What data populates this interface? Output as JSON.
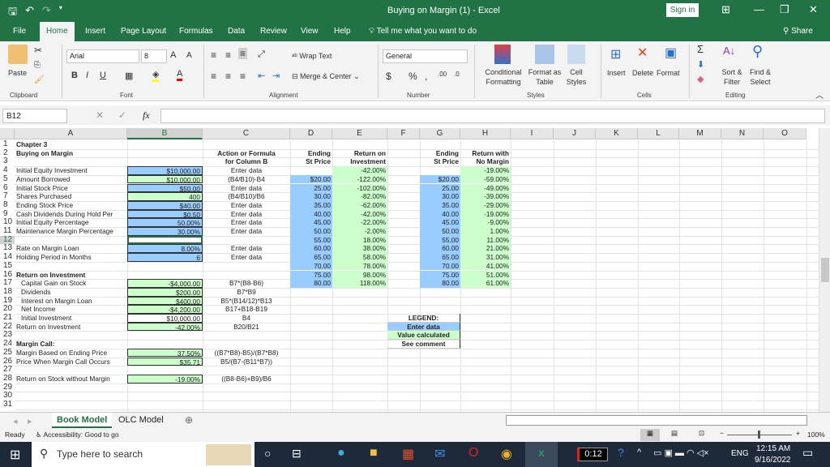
{
  "app": {
    "title": "Buying on Margin (1)  -  Excel",
    "sign_in": "Sign in"
  },
  "tabs": [
    "File",
    "Home",
    "Insert",
    "Page Layout",
    "Formulas",
    "Data",
    "Review",
    "View",
    "Help"
  ],
  "tell_me": "Tell me what you want to do",
  "share": "Share",
  "ribbon": {
    "clipboard": {
      "paste": "Paste",
      "label": "Clipboard"
    },
    "font": {
      "name": "Arial",
      "size": "8",
      "label": "Font"
    },
    "alignment": {
      "wrap_text": "Wrap Text",
      "merge_center": "Merge & Center",
      "label": "Alignment"
    },
    "number": {
      "format": "General",
      "label": "Number"
    },
    "styles": {
      "conditional": "Conditional Formatting",
      "format_table": "Format as Table",
      "cell_styles": "Cell Styles",
      "label": "Styles"
    },
    "cells": {
      "insert": "Insert",
      "delete": "Delete",
      "format": "Format",
      "label": "Cells"
    },
    "editing": {
      "sort": "Sort & Filter",
      "find": "Find & Select",
      "label": "Editing"
    }
  },
  "formula_bar": {
    "name_box": "B12",
    "fx": "fx",
    "value": ""
  },
  "columns": [
    "A",
    "B",
    "C",
    "D",
    "E",
    "F",
    "G",
    "H",
    "I",
    "J",
    "K",
    "L",
    "M",
    "N",
    "O"
  ],
  "sheet": {
    "A1": "Chapter 3",
    "A2": "Buying on Margin",
    "C2": "Action or Formula",
    "C3": "for Column B",
    "D2": "Ending",
    "D3": "St Price",
    "E2": "Return on",
    "E3": "Investment",
    "G2": "Ending",
    "G3": "St Price",
    "H2": "Return with",
    "H3": "No Margin",
    "rows_a": [
      [
        "Initial Equity Investment",
        "$10,000.00",
        "Enter data"
      ],
      [
        "Amount Borrowed",
        "$10,000.00",
        "(B4/B10)-B4"
      ],
      [
        "Initial Stock Price",
        "$50.00",
        "Enter data"
      ],
      [
        "Shares Purchased",
        "400",
        "(B4/B10)/B6"
      ],
      [
        "Ending Stock Price",
        "$40.00",
        "Enter data"
      ],
      [
        "Cash Dividends During Hold Per",
        "$0.50",
        "Enter data"
      ],
      [
        "Initial Equity Percentage",
        "50.00%",
        "Enter data"
      ],
      [
        "Maintenance Margin Percentage",
        "30.00%",
        "Enter data"
      ]
    ],
    "rows_b": [
      [
        "Rate on Margin Loan",
        "8.00%",
        "Enter data"
      ],
      [
        "Holding Period in Months",
        "6",
        "Enter data"
      ]
    ],
    "A16": "Return on Investment",
    "rows_c": [
      [
        "Capital Gain on Stock",
        "-$4,000.00",
        "B7*(B8-B6)"
      ],
      [
        "Dividends",
        "$200.00",
        "B7*B9"
      ],
      [
        "Interest on Margin Loan",
        "$400.00",
        "B5*(B14/12)*B13"
      ],
      [
        "Net Income",
        "-$4,200.00",
        "B17+B18-B19"
      ],
      [
        "Initial Investment",
        "$10,000.00",
        "B4"
      ],
      [
        "Return on Investment",
        "-42.00%",
        "B20/B21"
      ]
    ],
    "A24": "Margin Call:",
    "rows_d": [
      [
        "Margin Based on Ending Price",
        "37.50%",
        "((B7*B8)-B5)/(B7*B8)"
      ],
      [
        "Price When Margin Call Occurs",
        "$35.71",
        "B5/(B7-(B11*B7))"
      ]
    ],
    "row28": [
      "Return on Stock without Margin",
      "-19.00%",
      "((B8-B6)+B9)/B6"
    ],
    "E4": "-42.00%",
    "H4": "-19.00%",
    "price_table": [
      [
        "$20.00",
        "-122.00%",
        "$20.00",
        "-59.00%"
      ],
      [
        "25.00",
        "-102.00%",
        "25.00",
        "-49.00%"
      ],
      [
        "30.00",
        "-82.00%",
        "30.00",
        "-39.00%"
      ],
      [
        "35.00",
        "-62.00%",
        "35.00",
        "-29.00%"
      ],
      [
        "40.00",
        "-42.00%",
        "40.00",
        "-19.00%"
      ],
      [
        "45.00",
        "-22.00%",
        "45.00",
        "-9.00%"
      ],
      [
        "50.00",
        "-2.00%",
        "50.00",
        "1.00%"
      ],
      [
        "55.00",
        "18.00%",
        "55.00",
        "11.00%"
      ],
      [
        "60.00",
        "38.00%",
        "60.00",
        "21.00%"
      ],
      [
        "65.00",
        "58.00%",
        "65.00",
        "31.00%"
      ],
      [
        "70.00",
        "78.00%",
        "70.00",
        "41.00%"
      ],
      [
        "75.00",
        "98.00%",
        "75.00",
        "51.00%"
      ],
      [
        "80.00",
        "118.00%",
        "80.00",
        "61.00%"
      ]
    ],
    "legend": [
      "LEGEND:",
      "Enter data",
      "Value calculated",
      "See comment"
    ]
  },
  "sheet_tabs": [
    "Book Model",
    "OLC Model"
  ],
  "status": {
    "ready": "Ready",
    "accessibility": "Accessibility: Good to go",
    "zoom": "100%"
  },
  "taskbar": {
    "search": "Type here to search",
    "timer": "0:12",
    "lang": "ENG",
    "time": "12:15 AM",
    "date": "9/16/2022"
  }
}
